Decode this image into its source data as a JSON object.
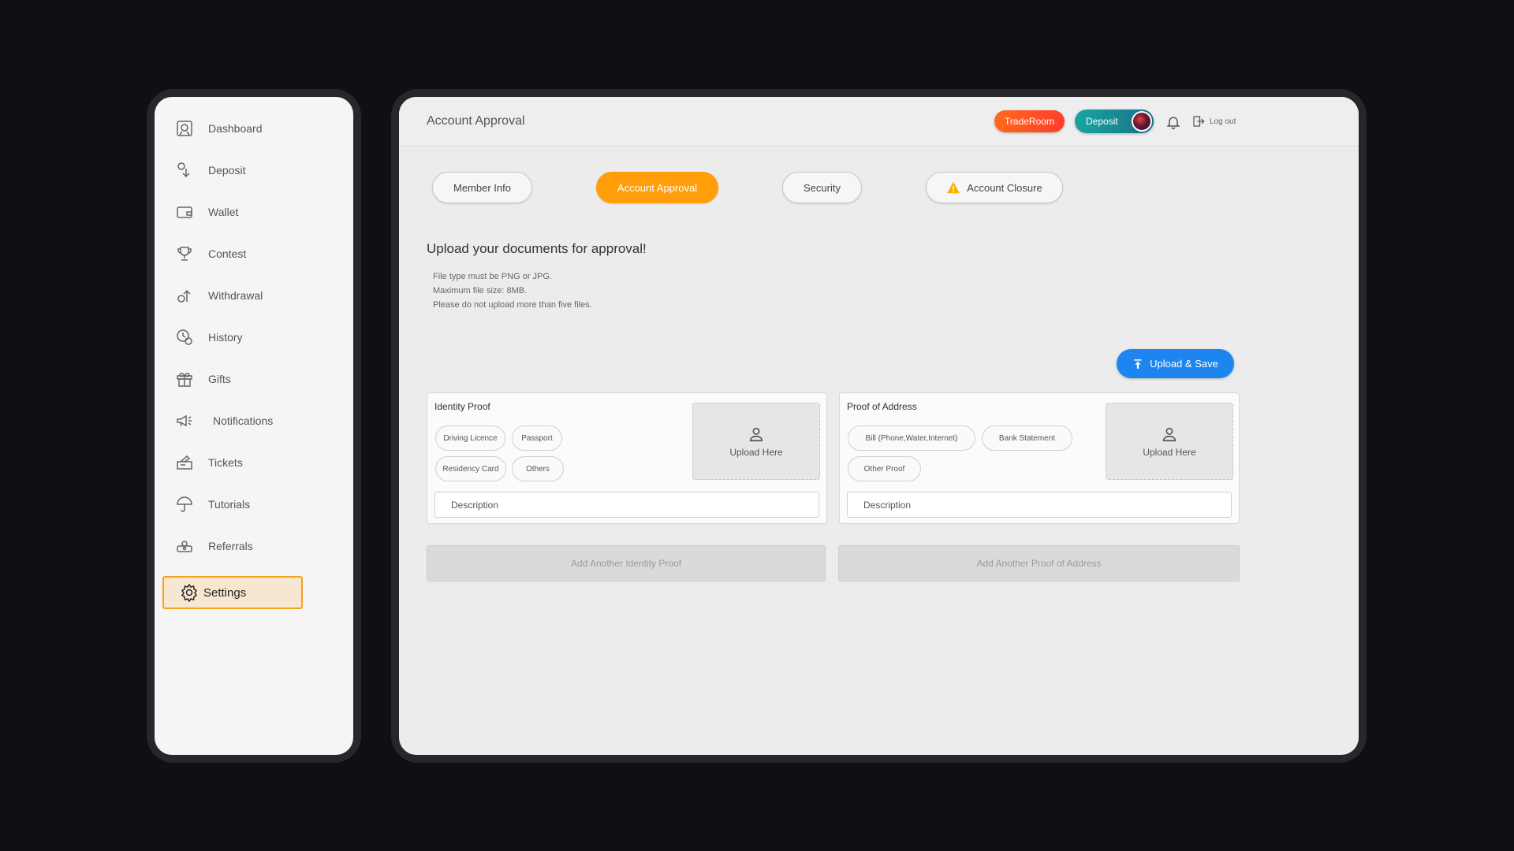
{
  "sidebar": {
    "items": [
      {
        "label": "Dashboard",
        "icon": "dashboard-icon"
      },
      {
        "label": "Deposit",
        "icon": "deposit-icon"
      },
      {
        "label": "Wallet",
        "icon": "wallet-icon"
      },
      {
        "label": "Contest",
        "icon": "trophy-icon"
      },
      {
        "label": "Withdrawal",
        "icon": "withdrawal-icon"
      },
      {
        "label": "History",
        "icon": "history-icon"
      },
      {
        "label": "Gifts",
        "icon": "gift-icon"
      },
      {
        "label": "Notifications",
        "icon": "megaphone-icon"
      },
      {
        "label": "Tickets",
        "icon": "ticket-icon"
      },
      {
        "label": "Tutorials",
        "icon": "umbrella-icon"
      },
      {
        "label": "Referrals",
        "icon": "referrals-icon"
      },
      {
        "label": "Settings",
        "icon": "gear-icon",
        "active": true
      }
    ]
  },
  "header": {
    "title": "Account Approval",
    "traderoom_label": "TradeRoom",
    "deposit_label": "Deposit",
    "logout_label": "Log out"
  },
  "tabs": [
    {
      "label": "Member Info"
    },
    {
      "label": "Account Approval",
      "active": true
    },
    {
      "label": "Security"
    },
    {
      "label": "Account Closure",
      "icon": "warning-icon"
    }
  ],
  "upload": {
    "title": "Upload your documents for approval!",
    "rules": [
      "File type must be PNG or JPG.",
      "Maximum file size: 8MB.",
      "Please do not upload more than five files."
    ],
    "save_label": "Upload & Save"
  },
  "identity": {
    "title": "Identity Proof",
    "chips": [
      "Driving Licence",
      "Passport",
      "Residency Card",
      "Others"
    ],
    "upload_label": "Upload Here",
    "description_placeholder": "Description",
    "add_label": "Add Another Identity Proof"
  },
  "address": {
    "title": "Proof of Address",
    "chips": [
      "Bill (Phone,Water,Internet)",
      "Bank Statement",
      "Other Proof"
    ],
    "upload_label": "Upload Here",
    "description_placeholder": "Description",
    "add_label": "Add Another Proof of Address"
  },
  "colors": {
    "accent_orange": "#ff9d0a",
    "traderoom": "#ff5a24",
    "deposit": "#16a7a0",
    "upload_blue": "#1d85f0",
    "active_nav_bg": "#f7e7d0"
  }
}
